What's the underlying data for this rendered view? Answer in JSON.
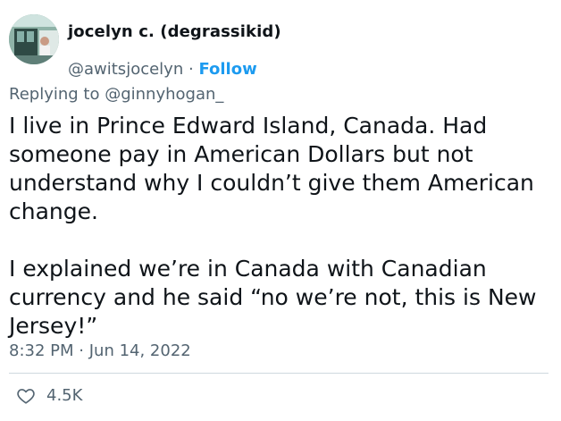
{
  "author": {
    "display_name": "jocelyn c. (degrassikid)",
    "handle": "@awitsjocelyn",
    "separator": "·",
    "follow_label": "Follow"
  },
  "reply": {
    "prefix": "Replying to",
    "mention": "@ginnyhogan_"
  },
  "tweet": {
    "text": "I live in Prince Edward Island, Canada. Had someone pay in American Dollars but not understand why I couldn’t give them American change.\n\nI explained we’re in Canada with Canadian currency and he said “no we’re not, this is New Jersey!”",
    "time": "8:32 PM",
    "separator": "·",
    "date": "Jun 14, 2022"
  },
  "stats": {
    "likes": "4.5K",
    "like_icon": "heart-icon"
  },
  "colors": {
    "accent": "#1d9bf0",
    "secondary_text": "#536471",
    "divider": "#cfd9de"
  }
}
